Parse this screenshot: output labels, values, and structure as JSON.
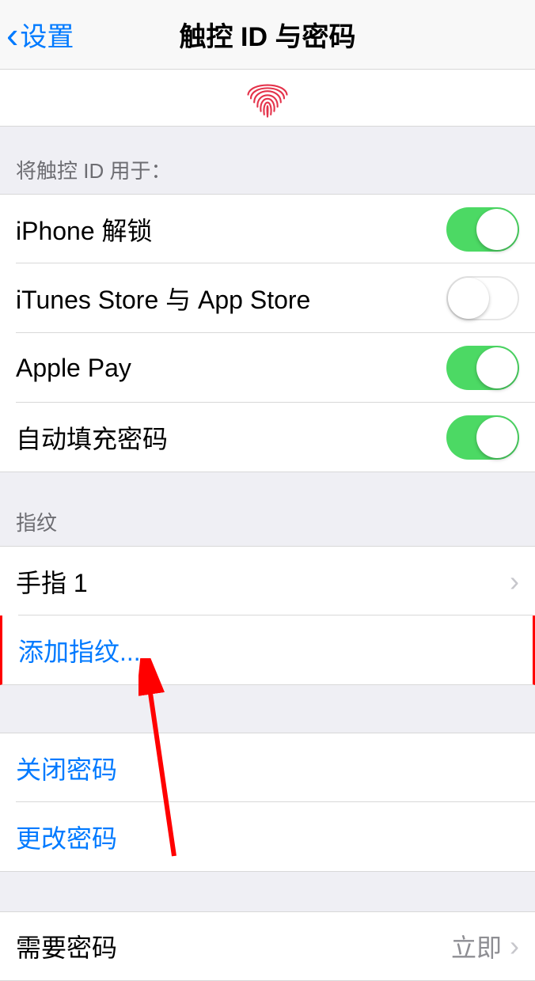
{
  "nav": {
    "back_label": "设置",
    "title": "触控 ID 与密码"
  },
  "sections": {
    "use_touchid": {
      "header": "将触控 ID 用于：",
      "items": [
        {
          "label": "iPhone 解锁",
          "on": true
        },
        {
          "label": "iTunes Store 与 App Store",
          "on": false
        },
        {
          "label": "Apple Pay",
          "on": true
        },
        {
          "label": "自动填充密码",
          "on": true
        }
      ]
    },
    "fingerprints": {
      "header": "指纹",
      "finger_label": "手指 1",
      "add_label": "添加指纹..."
    },
    "passcode": {
      "turn_off": "关闭密码",
      "change": "更改密码"
    },
    "require": {
      "label": "需要密码",
      "value": "立即"
    }
  }
}
